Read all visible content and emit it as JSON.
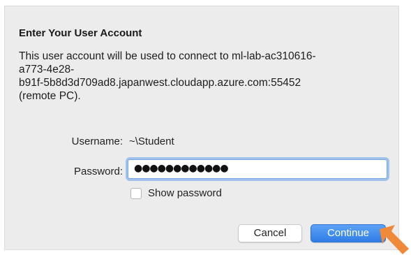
{
  "dialog": {
    "title": "Enter Your User Account",
    "message": "This user account will be used to connect to ml-lab-ac310616-\na773-4e28-\nb91f-5b8d3d709ad8.japanwest.cloudapp.azure.com:55452\n(remote PC).",
    "username_label": "Username:",
    "username_value": "~\\Student",
    "password_label": "Password:",
    "password_value": "●●●●●●●●●●●●",
    "show_password_label": "Show password",
    "show_password_checked": false,
    "cancel_label": "Cancel",
    "continue_label": "Continue"
  },
  "annotation": {
    "arrow_color": "#f08a3a"
  }
}
